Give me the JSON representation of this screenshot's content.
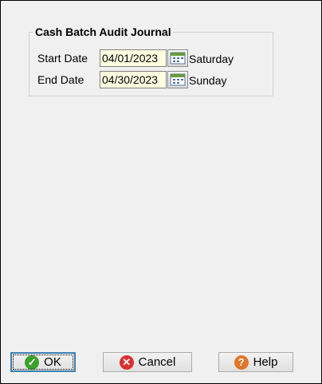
{
  "group": {
    "title": "Cash Batch Audit Journal"
  },
  "start": {
    "label": "Start Date",
    "value": "04/01/2023",
    "day": "Saturday"
  },
  "end": {
    "label": "End Date",
    "value": "04/30/2023",
    "day": "Sunday"
  },
  "buttons": {
    "ok": "OK",
    "cancel": "Cancel",
    "help": "Help"
  },
  "colors": {
    "input_bg": "#ffffe1",
    "ok_icon": "#3aa12a",
    "cancel_icon": "#d9302f",
    "help_icon": "#e0762a"
  },
  "icons": {
    "calendar": "calendar-icon",
    "ok": "check-icon",
    "cancel": "close-icon",
    "help": "help-icon"
  }
}
